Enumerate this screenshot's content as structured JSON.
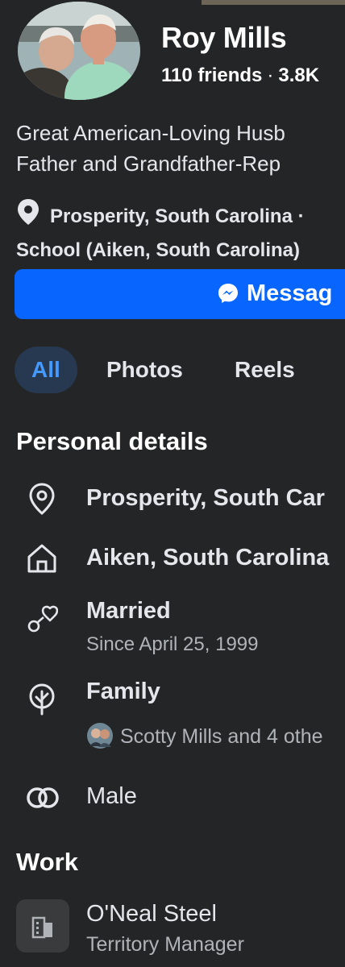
{
  "profile": {
    "name": "Roy Mills",
    "friends": "110 friends",
    "separator": "·",
    "followers": "3.8K",
    "bio_line1": "Great American-Loving Husb",
    "bio_line2": "Father and Grandfather-Rep",
    "location_line1": "Prosperity, South Carolina ·",
    "location_line2": "School (Aiken, South Carolina)"
  },
  "actions": {
    "message_label": "Messag"
  },
  "tabs": [
    {
      "label": "All",
      "active": true
    },
    {
      "label": "Photos",
      "active": false
    },
    {
      "label": "Reels",
      "active": false
    }
  ],
  "personal_details": {
    "title": "Personal details",
    "current_city": "Prosperity, South Car",
    "hometown": "Aiken, South Carolina",
    "relationship": "Married",
    "relationship_since": "Since April 25, 1999",
    "family_label": "Family",
    "family_members": "Scotty Mills and 4 othe",
    "gender": "Male"
  },
  "work": {
    "title": "Work",
    "company": "O'Neal Steel",
    "position": "Territory Manager"
  },
  "icons": {
    "location": "map-pin-icon",
    "hometown": "home-icon",
    "relationship": "hearts-icon",
    "family": "family-tree-icon",
    "gender": "gender-rings-icon",
    "messenger": "messenger-icon",
    "work": "building-icon"
  },
  "colors": {
    "background": "#242526",
    "accent": "#0866ff",
    "active_tab_bg": "#263951",
    "active_tab_text": "#4599ff",
    "secondary_text": "#b0b3b8"
  }
}
